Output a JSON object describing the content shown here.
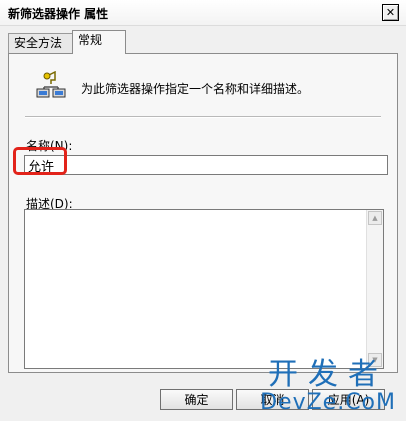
{
  "window": {
    "title": "新筛选器操作 属性",
    "close_glyph": "✕"
  },
  "tabs": [
    {
      "label": "安全方法"
    },
    {
      "label": "常规"
    }
  ],
  "general": {
    "header_text": "为此筛选器操作指定一个名称和详细描述。",
    "name_label": "名称(N):",
    "name_value": "允许",
    "description_label": "描述(D):",
    "description_value": ""
  },
  "buttons": {
    "ok": "确定",
    "cancel": "取消",
    "apply": "应用(A)"
  },
  "watermark": {
    "line1": "开发者",
    "line2": "DevZe.CoM"
  },
  "colors": {
    "highlight": "#e2231a",
    "watermark": "#1f6fb8"
  }
}
